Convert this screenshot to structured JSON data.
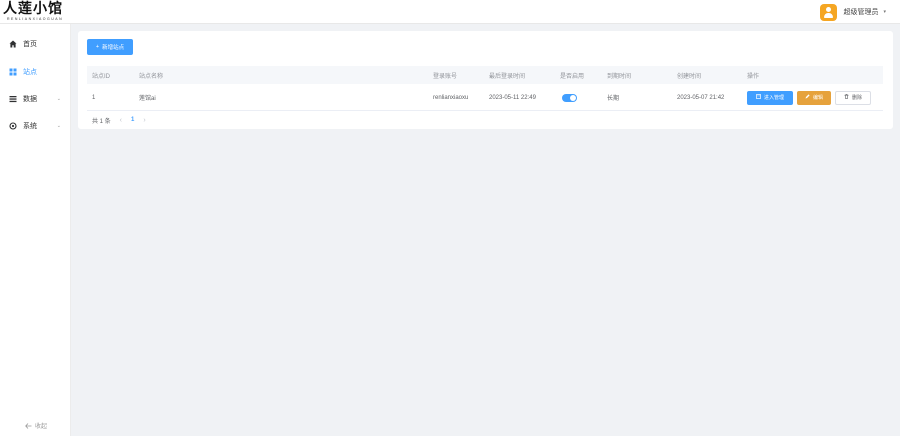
{
  "header": {
    "logo_text": "人莲小馆",
    "logo_sub": "RENLIANXIAOGUAN",
    "user_name": "超级管理员",
    "caret": "▾"
  },
  "sidebar": {
    "items": [
      {
        "label": "首页",
        "icon": "home-icon"
      },
      {
        "label": "站点",
        "icon": "grid-icon"
      },
      {
        "label": "数据",
        "icon": "list-icon"
      },
      {
        "label": "系统",
        "icon": "gear-icon"
      }
    ],
    "collapse_label": "收起"
  },
  "main": {
    "new_button": "新增站点",
    "table": {
      "headers": [
        "站点ID",
        "站点名称",
        "登录账号",
        "最后登录时间",
        "是否启用",
        "到期时间",
        "创建时间",
        "操作"
      ],
      "rows": [
        {
          "id": "1",
          "name": "莲馆ai",
          "account": "renlianxiaoxu",
          "last_login": "2023-05-11 22:49",
          "enabled": true,
          "expire": "长期",
          "created": "2023-05-07 21:42"
        }
      ],
      "actions": {
        "enter": "进入管理",
        "edit": "编辑",
        "delete": "删除"
      }
    },
    "pagination": {
      "total": "共 1 条",
      "current": "1"
    }
  },
  "colors": {
    "primary": "#409eff",
    "warning": "#e6a23c",
    "avatar": "#f5a623"
  }
}
